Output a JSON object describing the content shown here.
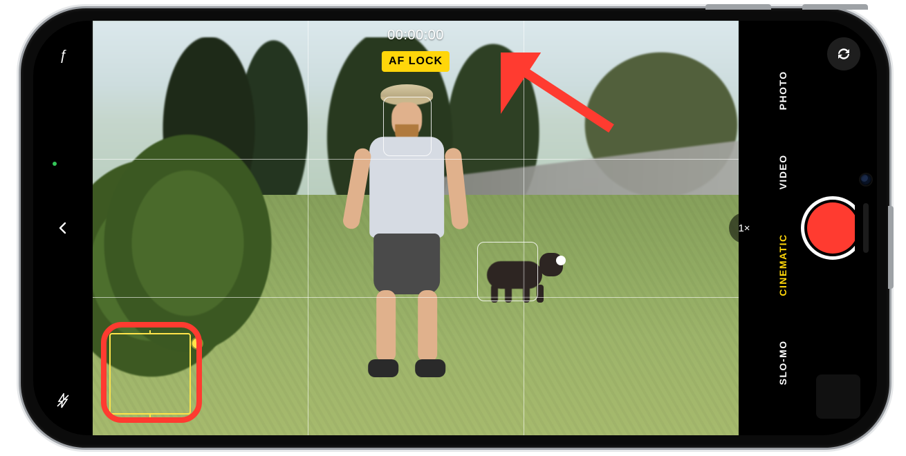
{
  "timer": "00:00:00",
  "af_lock_label": "AF LOCK",
  "zoom_label": "1×",
  "modes": {
    "items": [
      "SLO-MO",
      "CINEMATIC",
      "VIDEO",
      "PHOTO"
    ],
    "active_index": 1
  },
  "left_controls": {
    "depth_icon": "ƒ",
    "flash_icon": "flash-off"
  },
  "right_controls": {
    "flip_icon": "flip-camera"
  }
}
